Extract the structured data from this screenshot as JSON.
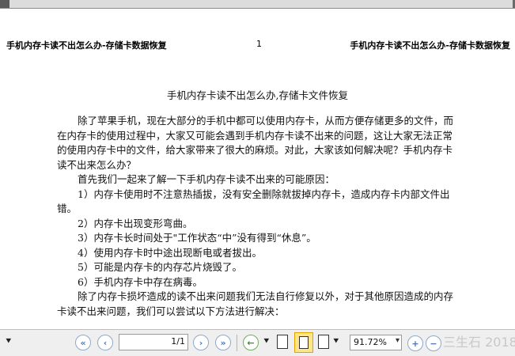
{
  "header": {
    "left": "手机内存卡读不出怎么办-存储卡数据恢复",
    "page_number": "1",
    "right": "手机内存卡读不出怎么办-存储卡数据恢复"
  },
  "document": {
    "title": "手机内存卡读不出怎么办,存储卡文件恢复",
    "paragraphs": [
      "除了苹果手机，现在大部分的手机中都可以使用内存卡，从而方便存储更多的文件，而在内存卡的使用过程中，大家又可能会遇到手机内存卡读不出来的问题，这让大家无法正常的使用内存卡中的文件，给大家带来了很大的麻烦。对此，大家该如何解决呢？手机内存卡读不出来怎么办？",
      "首先我们一起来了解一下手机内存卡读不出来的可能原因：",
      "1）内存卡使用时不注意热插拔，没有安全删除就拔掉内存卡，造成内存卡内部文件出错。",
      "2）内存卡出现变形弯曲。",
      "3）内存卡长时间处于\"工作状态“中”没有得到“休息”。",
      "4）使用内存卡时中途出现断电或者拔出。",
      "5）可能是内存卡的内存芯片烧毁了。",
      "6）手机内存卡中存在病毒。",
      "除了内存卡损坏造成的读不出来问题我们无法自行修复以外，对于其他原因造成的内存卡读不出来问题，我们可以尝试以下方法进行解决："
    ]
  },
  "toolbar": {
    "expand_icon": "double-chevron-down-icon",
    "first_page_icon": "double-chevron-left-icon",
    "prev_page_icon": "chevron-left-icon",
    "page_input_value": "1/1",
    "next_page_icon": "chevron-right-icon",
    "last_page_icon": "double-chevron-right-icon",
    "back_icon": "arrow-left-icon",
    "zoom_value": "91.72%",
    "watermark_text": "三生石 2018"
  },
  "colors": {
    "nav_blue": "#4b77b4",
    "nav_green": "#3e8f2b",
    "selected_bg": "#ffe58a",
    "selected_border": "#e2a200",
    "toolbar_bg": "#efefef"
  }
}
